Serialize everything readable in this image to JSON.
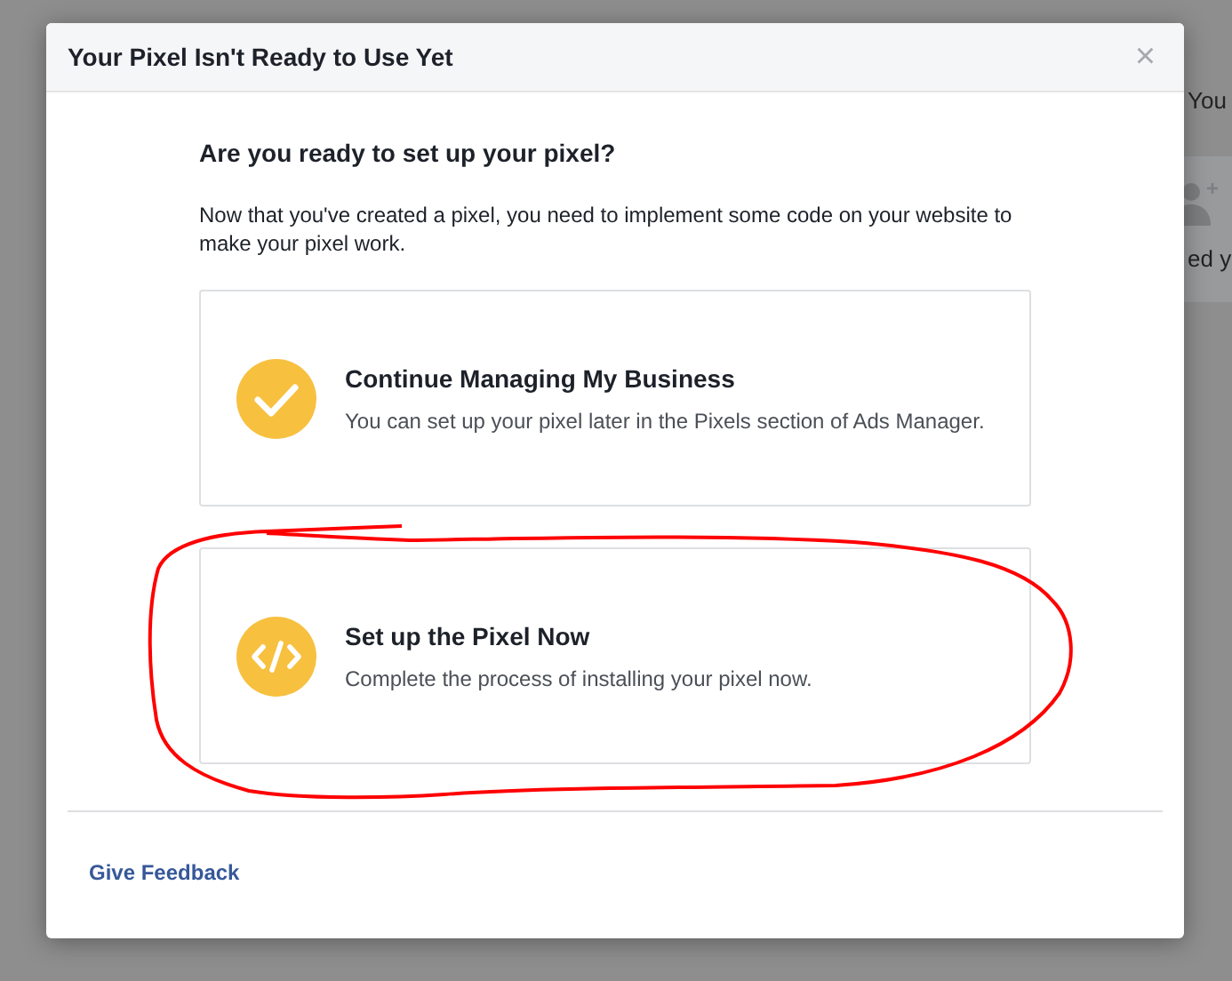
{
  "background": {
    "texts": [
      "You",
      "ed y"
    ]
  },
  "dialog": {
    "title": "Your Pixel Isn't Ready to Use Yet",
    "close": "×",
    "heading": "Are you ready to set up your pixel?",
    "intro": "Now that you've created a pixel, you need to implement some code on your website to make your pixel work.",
    "options": [
      {
        "kind": "check",
        "title": "Continue Managing My Business",
        "description": "You can set up your pixel later in the Pixels section of Ads Manager."
      },
      {
        "kind": "code",
        "title": "Set up the Pixel Now",
        "description": "Complete the process of installing your pixel now."
      }
    ],
    "footer_link": "Give Feedback"
  }
}
